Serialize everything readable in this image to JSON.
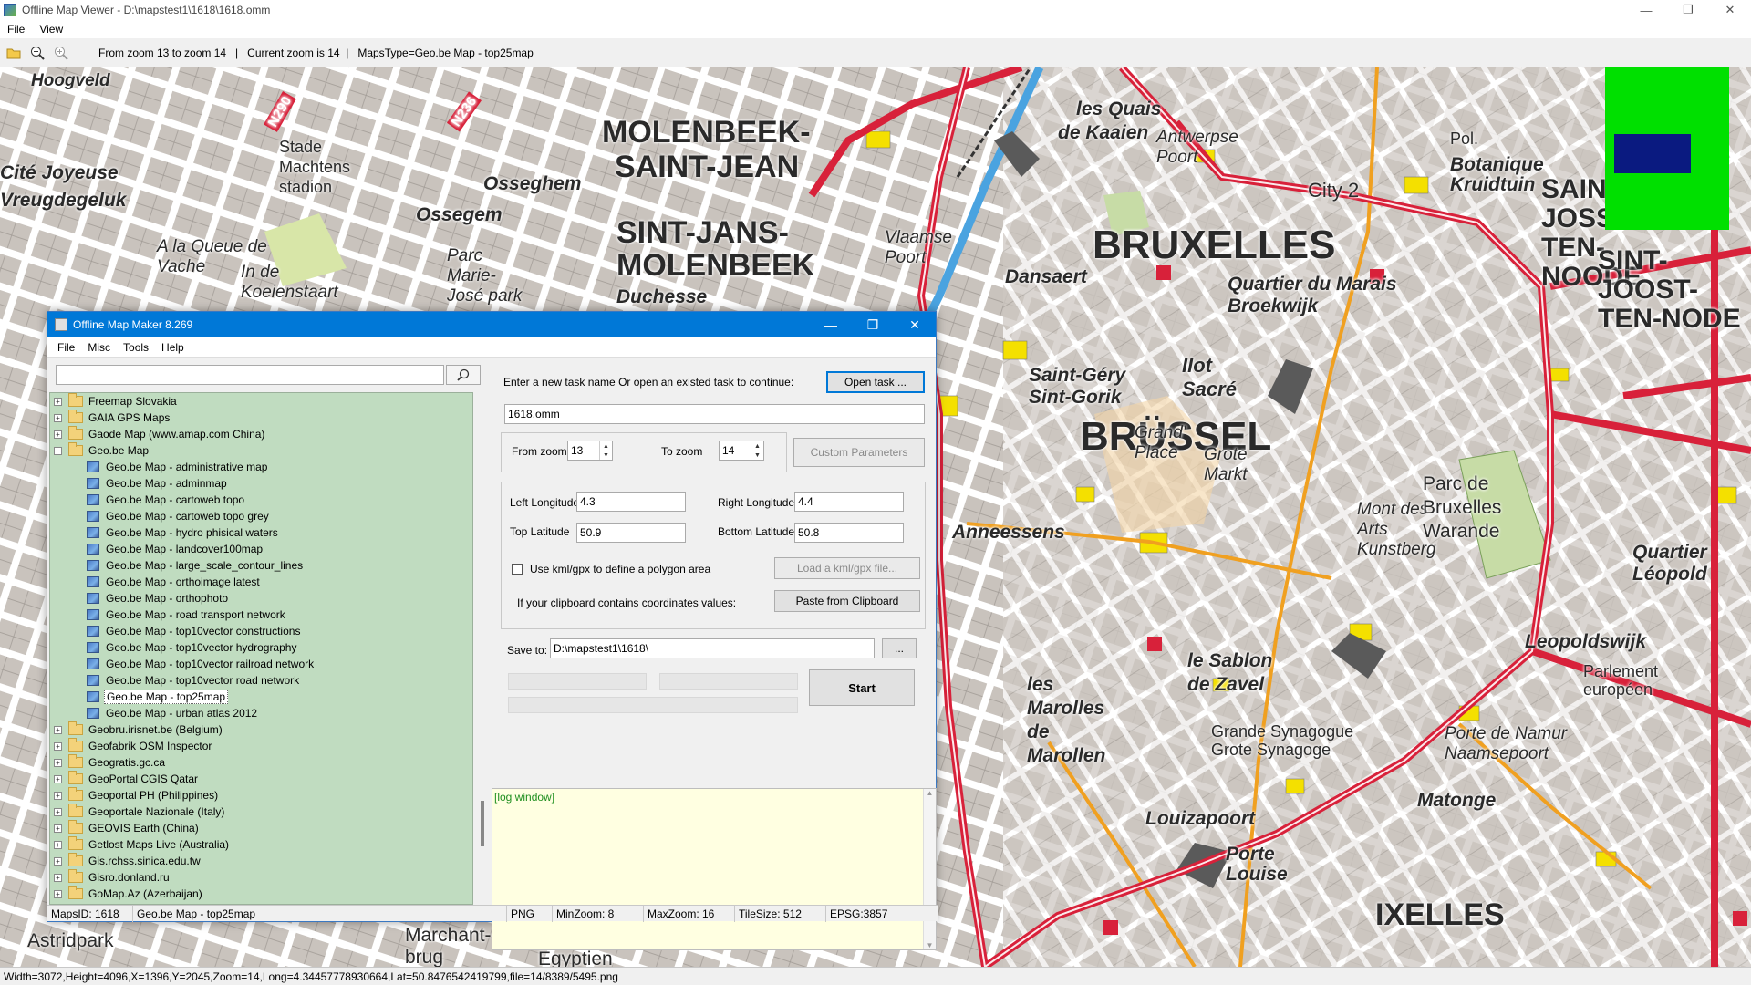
{
  "app": {
    "title": "Offline Map Viewer - D:\\mapstest1\\1618\\1618.omm",
    "menu": [
      "File",
      "View"
    ],
    "toolbar_info": "From zoom 13 to zoom 14   |   Current zoom is 14  |   MapsType=Geo.be Map - top25map",
    "status": "Width=3072,Height=4096,X=1396,Y=2045,Zoom=14,Long=4.34457778930664,Lat=50.8476542419799,file=14/8389/5495.png",
    "window_controls": [
      "—",
      "❐",
      "✕"
    ]
  },
  "map": {
    "labels": [
      {
        "text": "Hoogveld",
        "style": "italic"
      },
      {
        "text": "N290",
        "style": "road"
      },
      {
        "text": "N236",
        "style": "road"
      },
      {
        "text": "Cité Joyeuse",
        "style": "italic"
      },
      {
        "text": "Vreugdegeluk",
        "style": "italic"
      },
      {
        "text": "Stade Machtens stadion",
        "style": "plain"
      },
      {
        "text": "Osseghem",
        "style": "italic"
      },
      {
        "text": "Ossegem",
        "style": "italic"
      },
      {
        "text": "MOLENBEEK-",
        "style": "district"
      },
      {
        "text": "SAINT-JEAN",
        "style": "district"
      },
      {
        "text": "SINT-JANS-",
        "style": "district"
      },
      {
        "text": "MOLENBEEK",
        "style": "district"
      },
      {
        "text": "Duchesse",
        "style": "italic"
      },
      {
        "text": "A la Queue de Vache",
        "style": "italic"
      },
      {
        "text": "In de Koeienstaart",
        "style": "italic"
      },
      {
        "text": "Parc Marie-José park",
        "style": "italic"
      },
      {
        "text": "les Quais",
        "style": "italic"
      },
      {
        "text": "de Kaaien",
        "style": "italic"
      },
      {
        "text": "Antwerpse Poort",
        "style": "italic"
      },
      {
        "text": "Botanique Kruidtuin",
        "style": "italic"
      },
      {
        "text": "City 2",
        "style": "plain"
      },
      {
        "text": "BRUXELLES",
        "style": "city"
      },
      {
        "text": "BRÜSSEL",
        "style": "city"
      },
      {
        "text": "Quartier du Marais Broekwijk",
        "style": "italic"
      },
      {
        "text": "Dansaert",
        "style": "italic"
      },
      {
        "text": "Vlaamse Poort",
        "style": "italic"
      },
      {
        "text": "Saint-Géry Sint-Gorik",
        "style": "italic"
      },
      {
        "text": "Ilot Sacré",
        "style": "italic"
      },
      {
        "text": "Grand' Place",
        "style": "italic"
      },
      {
        "text": "Grote Markt",
        "style": "italic"
      },
      {
        "text": "Anneessens",
        "style": "italic"
      },
      {
        "text": "Mont des Arts Kunstberg",
        "style": "italic"
      },
      {
        "text": "Parc de Bruxelles Warande",
        "style": "italic"
      },
      {
        "text": "le Sablon de Zavel",
        "style": "italic"
      },
      {
        "text": "les Marolles de Marollen",
        "style": "italic"
      },
      {
        "text": "Grande Synagogue Grote Synagoge",
        "style": "plain"
      },
      {
        "text": "Louizapoort",
        "style": "italic"
      },
      {
        "text": "Porte Louise",
        "style": "italic"
      },
      {
        "text": "Porte de Namur Naamsepoort",
        "style": "italic"
      },
      {
        "text": "Matonge",
        "style": "italic"
      },
      {
        "text": "Leopoldswijk",
        "style": "italic"
      },
      {
        "text": "Quartier Léopold",
        "style": "italic"
      },
      {
        "text": "IXELLES",
        "style": "city"
      },
      {
        "text": "SAINT-JOSSE-TEN-NOODE",
        "style": "district"
      },
      {
        "text": "SINT-JOOST-TEN-NODE",
        "style": "district"
      },
      {
        "text": "Parlement européen",
        "style": "plain"
      },
      {
        "text": "Marchant-brug",
        "style": "plain"
      },
      {
        "text": "Pont Egyptien",
        "style": "plain"
      },
      {
        "text": "Astridpark",
        "style": "plain"
      },
      {
        "text": "Pol.",
        "style": "plain"
      }
    ],
    "colors": {
      "ring_road": "#d8213a",
      "roads": "#ffffff",
      "blocks": "#c8c2bc",
      "water": "#4aa3e0"
    }
  },
  "overview": {
    "bg": "#00e000",
    "viewport": "#0a1a80"
  },
  "maker": {
    "title": "Offline Map Maker 8.269",
    "menu": [
      "File",
      "Misc",
      "Tools",
      "Help"
    ],
    "search": {
      "value": "",
      "placeholder": ""
    },
    "tree": [
      {
        "label": "Freemap Slovakia",
        "type": "folder",
        "expanded": false
      },
      {
        "label": "GAIA GPS Maps",
        "type": "folder",
        "expanded": false
      },
      {
        "label": "Gaode Map (www.amap.com China)",
        "type": "folder",
        "expanded": false
      },
      {
        "label": "Geo.be Map",
        "type": "folder",
        "expanded": true
      },
      {
        "label": "Geo.be Map - administrative map",
        "type": "map"
      },
      {
        "label": "Geo.be Map - adminmap",
        "type": "map"
      },
      {
        "label": "Geo.be Map - cartoweb topo",
        "type": "map"
      },
      {
        "label": "Geo.be Map - cartoweb topo grey",
        "type": "map"
      },
      {
        "label": "Geo.be Map - hydro phisical waters",
        "type": "map"
      },
      {
        "label": "Geo.be Map - landcover100map",
        "type": "map"
      },
      {
        "label": "Geo.be Map - large_scale_contour_lines",
        "type": "map"
      },
      {
        "label": "Geo.be Map - orthoimage latest",
        "type": "map"
      },
      {
        "label": "Geo.be Map - orthophoto",
        "type": "map"
      },
      {
        "label": "Geo.be Map - road transport network",
        "type": "map"
      },
      {
        "label": "Geo.be Map - top10vector constructions",
        "type": "map"
      },
      {
        "label": "Geo.be Map - top10vector hydrography",
        "type": "map"
      },
      {
        "label": "Geo.be Map - top10vector railroad network",
        "type": "map"
      },
      {
        "label": "Geo.be Map - top10vector road network",
        "type": "map"
      },
      {
        "label": "Geo.be Map - top25map",
        "type": "map",
        "selected": true
      },
      {
        "label": "Geo.be Map - urban atlas 2012",
        "type": "map"
      },
      {
        "label": "Geobru.irisnet.be (Belgium)",
        "type": "folder",
        "expanded": false
      },
      {
        "label": "Geofabrik OSM Inspector",
        "type": "folder",
        "expanded": false
      },
      {
        "label": "Geogratis.gc.ca",
        "type": "folder",
        "expanded": false
      },
      {
        "label": "GeoPortal CGIS Qatar",
        "type": "folder",
        "expanded": false
      },
      {
        "label": "Geoportal PH (Philippines)",
        "type": "folder",
        "expanded": false
      },
      {
        "label": "Geoportale Nazionale (Italy)",
        "type": "folder",
        "expanded": false
      },
      {
        "label": "GEOVIS Earth (China)",
        "type": "folder",
        "expanded": false
      },
      {
        "label": "Getlost Maps Live (Australia)",
        "type": "folder",
        "expanded": false
      },
      {
        "label": "Gis.rchss.sinica.edu.tw",
        "type": "folder",
        "expanded": false
      },
      {
        "label": "Gisro.donland.ru",
        "type": "folder",
        "expanded": false
      },
      {
        "label": "GoMap.Az (Azerbaijan)",
        "type": "folder",
        "expanded": false
      }
    ],
    "task_prompt": "Enter a new task name Or open an existed task to continue:",
    "open_task_button": "Open task ...",
    "task_name": "1618.omm",
    "from_zoom_label": "From zoom",
    "from_zoom": "13",
    "to_zoom_label": "To zoom",
    "to_zoom": "14",
    "custom_params_button": "Custom Parameters",
    "left_lon_label": "Left Longitude",
    "left_lon": "4.3",
    "right_lon_label": "Right Longitude",
    "right_lon": "4.4",
    "top_lat_label": "Top Latitude",
    "top_lat": "50.9",
    "bottom_lat_label": "Bottom Latitude",
    "bottom_lat": "50.8",
    "kml_checkbox_label": "Use kml/gpx to define a polygon area",
    "load_kml_button": "Load a kml/gpx file...",
    "clipboard_label": "If your clipboard contains coordinates values:",
    "paste_button": "Paste from Clipboard",
    "save_to_label": "Save to:",
    "save_to": "D:\\mapstest1\\1618\\",
    "browse_button": "...",
    "start_button": "Start",
    "log_text": "[log window]",
    "status": {
      "maps_id": "MapsID: 1618",
      "map_name": "Geo.be Map - top25map",
      "format": "PNG",
      "min_zoom": "MinZoom: 8",
      "max_zoom": "MaxZoom: 16",
      "tile_size": "TileSize: 512",
      "epsg": "EPSG:3857"
    }
  }
}
